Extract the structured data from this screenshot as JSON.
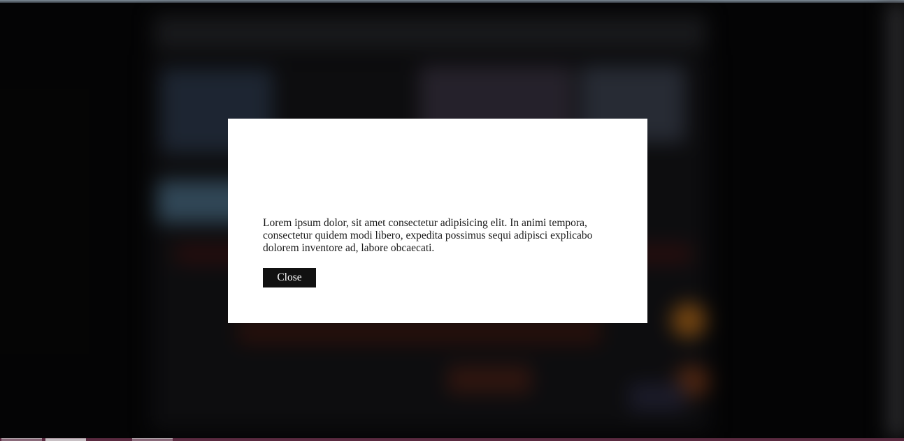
{
  "modal": {
    "body_text": "Lorem ipsum dolor, sit amet consectetur adipisicing elit. In animi tempora, consectetur quidem modi libero, expedita possimus sequi adipisci explicabo dolorem inventore ad, labore obcaecati.",
    "close_label": "Close"
  },
  "colors": {
    "overlay": "#000000",
    "modal_background": "#ffffff",
    "button_background": "#111111",
    "button_text": "#ffffff"
  }
}
